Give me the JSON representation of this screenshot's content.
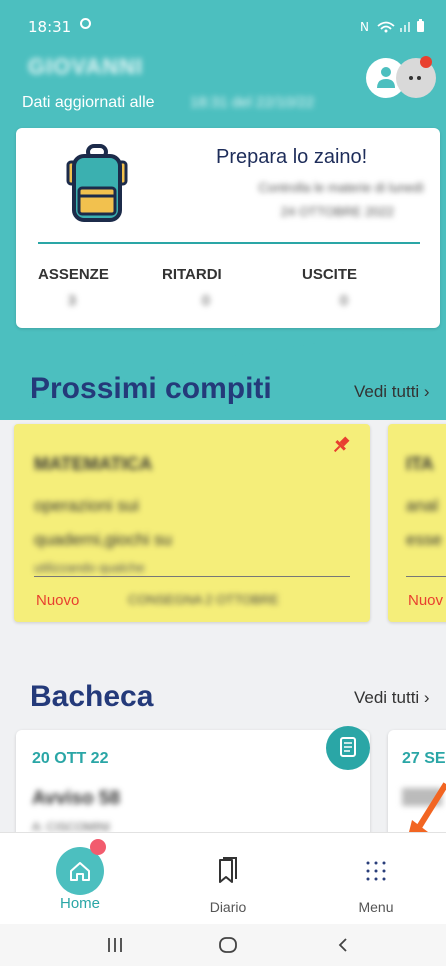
{
  "status_bar": {
    "time": "18:31",
    "icons": [
      "sim-icon",
      "wifi-icon",
      "signal-icon",
      "battery-icon"
    ]
  },
  "header": {
    "student_name": "GIOVANNI",
    "updated_label": "Dati aggiornati alle",
    "updated_value": "18:31 del 22/10/22"
  },
  "summary_card": {
    "title": "Prepara lo zaino!",
    "subtitle_line1": "Controlla le materie di lunedì",
    "subtitle_line2": "24 OTTOBRE 2022",
    "stats": [
      {
        "label": "ASSENZE",
        "value": "3"
      },
      {
        "label": "RITARDI",
        "value": "0"
      },
      {
        "label": "USCITE",
        "value": "0"
      }
    ]
  },
  "compiti": {
    "title": "Prossimi compiti",
    "see_all": "Vedi tutti ›",
    "cards": [
      {
        "subject": "MATEMATICA",
        "line1": "operazioni sui",
        "line2": "quaderni,giochi su",
        "line3": "utilizzando qualche",
        "status": "Nuovo",
        "date": "CONSEGNA 2 OTTOBRE"
      },
      {
        "subject": "ITA",
        "line1": "anal",
        "line2": "esse",
        "status": "Nuov"
      }
    ]
  },
  "bacheca": {
    "title": "Bacheca",
    "see_all": "Vedi tutti ›",
    "cards": [
      {
        "date": "20 OTT 22",
        "title": "Avviso 58",
        "sub": "A: CISCOMINI"
      },
      {
        "date": "27 SE"
      }
    ]
  },
  "nav": {
    "items": [
      {
        "label": "Home"
      },
      {
        "label": "Diario"
      },
      {
        "label": "Menu"
      }
    ]
  },
  "colors": {
    "teal": "#4cbfbf",
    "navy": "#243a7a",
    "red": "#e8402f",
    "yellow": "#f5ee7a"
  }
}
